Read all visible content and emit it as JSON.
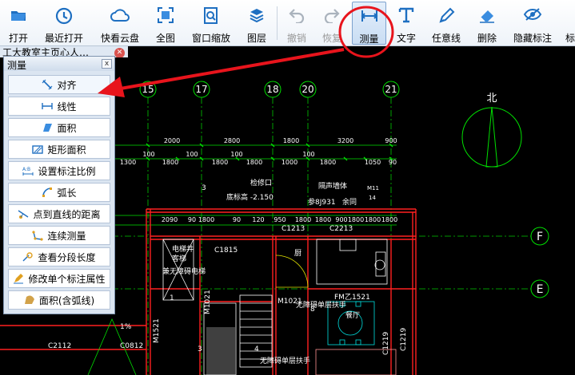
{
  "toolbar": {
    "buttons": [
      {
        "label": "打开",
        "icon": "folder-icon"
      },
      {
        "label": "最近打开",
        "icon": "recent-icon"
      },
      {
        "label": "快看云盘",
        "icon": "cloud-icon"
      },
      {
        "label": "全图",
        "icon": "fit-view-icon"
      },
      {
        "label": "窗口缩放",
        "icon": "zoom-window-icon"
      },
      {
        "label": "图层",
        "icon": "layers-icon"
      },
      {
        "label": "撤销",
        "icon": "undo-icon"
      },
      {
        "label": "恢复",
        "icon": "redo-icon"
      },
      {
        "label": "测量",
        "icon": "measure-icon"
      },
      {
        "label": "文字",
        "icon": "text-icon"
      },
      {
        "label": "任意线",
        "icon": "pen-icon"
      },
      {
        "label": "删除",
        "icon": "eraser-icon"
      },
      {
        "label": "隐藏标注",
        "icon": "eye-icon"
      },
      {
        "label": "标",
        "icon": ""
      }
    ]
  },
  "doc_tab": {
    "label": "工大教室主页心人…"
  },
  "measure_panel": {
    "title": "测量",
    "close": "x",
    "items": [
      {
        "label": "对齐",
        "icon": "aligned-dimension-icon"
      },
      {
        "label": "线性",
        "icon": "linear-dimension-icon"
      },
      {
        "label": "面积",
        "icon": "area-icon"
      },
      {
        "label": "矩形面积",
        "icon": "rectangle-area-icon"
      },
      {
        "label": "设置标注比例",
        "icon": "scale-icon"
      },
      {
        "label": "弧长",
        "icon": "arc-length-icon"
      },
      {
        "label": "点到直线的距离",
        "icon": "point-line-distance-icon"
      },
      {
        "label": "连续测量",
        "icon": "continuous-measure-icon"
      },
      {
        "label": "查看分段长度",
        "icon": "segment-length-icon"
      },
      {
        "label": "修改单个标注属性",
        "icon": "edit-dimension-icon"
      },
      {
        "label": "面积(含弧线)",
        "icon": "arc-area-icon"
      }
    ]
  },
  "drawing": {
    "axis_labels": [
      "15",
      "17",
      "18",
      "20",
      "21",
      "F",
      "E"
    ],
    "north": "北",
    "dims_top": [
      "2000",
      "2800",
      "1800",
      "3200",
      "900"
    ],
    "dims_second": [
      "1300",
      "100",
      "1800",
      "100",
      "1800",
      "100",
      "1800",
      "1000",
      "100",
      "1800",
      "1050",
      "90"
    ],
    "dims_third": [
      "2090",
      "90",
      "1800",
      "90",
      "120",
      "950",
      "1800",
      "1800",
      "900",
      "1800",
      "1800",
      "1800"
    ],
    "annotations": [
      "检修口",
      "底标高 -2.150",
      "隔声墙体",
      "参8J931 ",
      "余同",
      "M11",
      "14",
      "C1213",
      "C2213",
      "C1815",
      "电梯井",
      "客梯",
      "兼无障碍电梯",
      "M1021",
      "无障碍单层扶手",
      "FM乙1521",
      "厨",
      "餐厅",
      "M1521",
      "1%",
      "C2112",
      "C0812",
      "C1219",
      "C1219",
      "无障碍单层扶手",
      "3",
      "1",
      "3",
      "4",
      "8",
      "M1021"
    ]
  },
  "colors": {
    "background": "#000000",
    "grid_line": "#00ff00",
    "wall": "#ff0000",
    "text": "#ffffff",
    "callout": "#e8141c"
  }
}
